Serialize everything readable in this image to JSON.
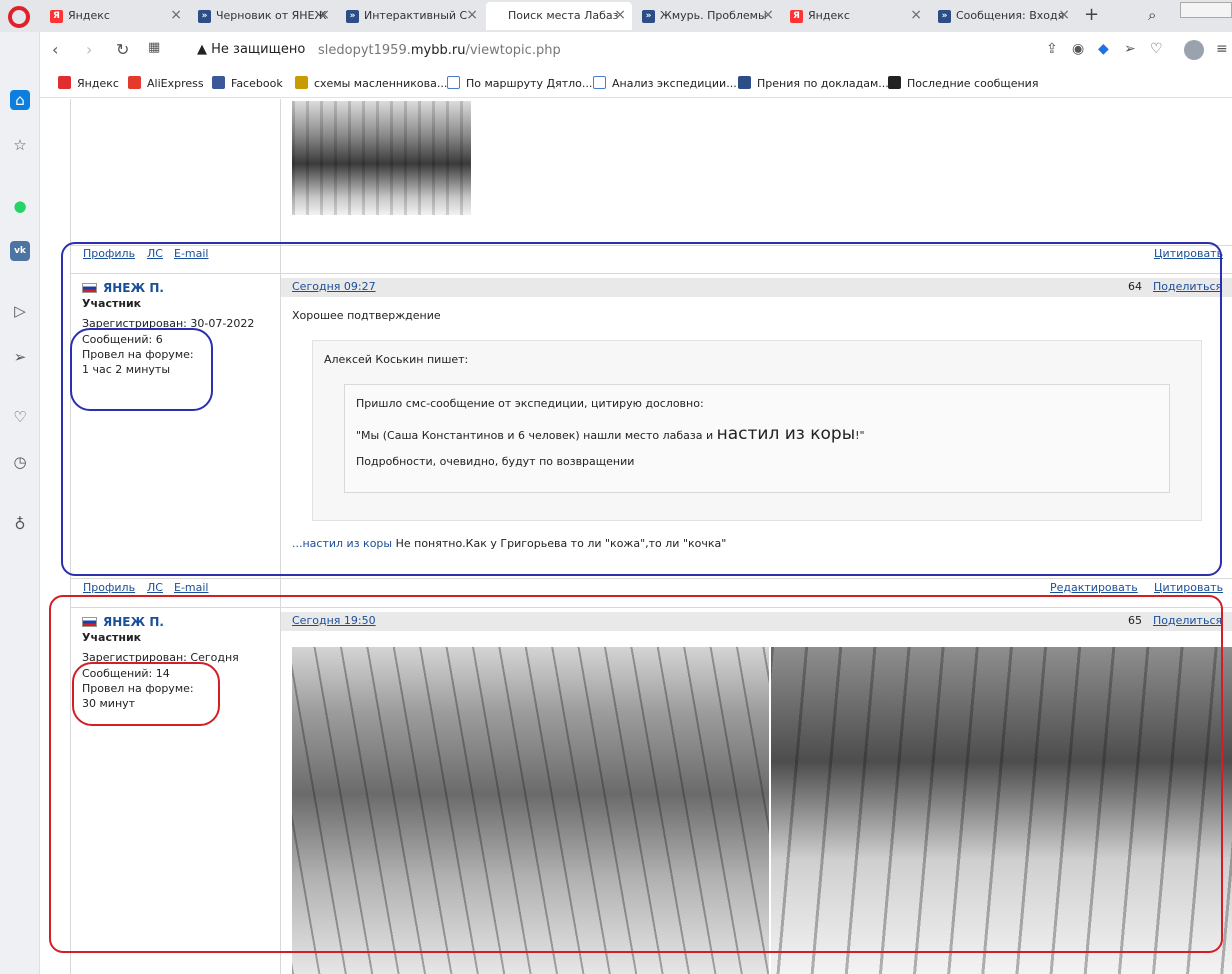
{
  "tabs": [
    {
      "label": "Яндекс",
      "icon": "yandex-icon",
      "active": false
    },
    {
      "label": "Черновик от ЯНЕЖ",
      "icon": "mybb-icon",
      "active": false
    },
    {
      "label": "Интерактивный С",
      "icon": "mybb-icon",
      "active": false
    },
    {
      "label": "Поиск места Лабаз",
      "icon": "none",
      "active": true
    },
    {
      "label": "Жмурь. Проблемы",
      "icon": "mybb-icon",
      "active": false
    },
    {
      "label": "Яндекс",
      "icon": "yandex-icon",
      "active": false
    },
    {
      "label": "Сообщения: Входя",
      "icon": "mybb-icon",
      "active": false
    }
  ],
  "address": {
    "security": "Не защищено",
    "url_prefix": "sledopyt1959.",
    "url_domain": "mybb.ru",
    "url_path": "/viewtopic.php"
  },
  "bookmarks": [
    {
      "label": "Яндекс",
      "color": "#e12d2d"
    },
    {
      "label": "AliExpress",
      "color": "#e4392b"
    },
    {
      "label": "Facebook",
      "color": "#3b5998"
    },
    {
      "label": "схемы масленникова...",
      "color": "#c89b00"
    },
    {
      "label": "По маршруту Дятло...",
      "color": "#4a7bd0"
    },
    {
      "label": "Анализ экспедиции....",
      "color": "#4a7bd0"
    },
    {
      "label": "Прения по докладам...",
      "color": "#2d4d86"
    },
    {
      "label": "Последние сообщения",
      "color": "#222222"
    }
  ],
  "post_links": {
    "profile": "Профиль",
    "pm": "ЛС",
    "email": "E-mail",
    "quote": "Цитировать",
    "edit": "Редактировать",
    "share": "Поделиться"
  },
  "post1": {
    "username": "ЯНЕЖ П.",
    "role": "Участник",
    "registered": "Зарегистрирован: 30-07-2022",
    "posts": "Сообщений: 6",
    "time_label": "Провел на форуме:",
    "time_value": "1 час 2 минуты",
    "date": "Сегодня 09:27",
    "number": "64",
    "text": "Хорошее подтверждение",
    "quote_author": "Алексей Коськин пишет:",
    "inner_line1": "Пришло смс-сообщение от экспедиции, цитирую дословно:",
    "inner_line2_a": "\"Мы (Саша Константинов и 6 человек) нашли место лабаза и ",
    "inner_line2_big": "настил из коры",
    "inner_line2_b": "!\"",
    "inner_line3": "Подробности, очевидно, будут по возвращении",
    "reply_highlight": "...настил из коры",
    "reply_text": " Не понятно.Как у Григорьева то ли \"кожа\",то ли \"кочка\""
  },
  "post2": {
    "username": "ЯНЕЖ П.",
    "role": "Участник",
    "registered": "Зарегистрирован: Сегодня",
    "posts": "Сообщений: 14",
    "time_label": "Провел на форуме:",
    "time_value": "30 минут",
    "date": "Сегодня 19:50",
    "number": "65"
  },
  "colors": {
    "link": "#1a4f99",
    "annotation_blue": "#2b2fb0",
    "annotation_red": "#d41e25"
  }
}
